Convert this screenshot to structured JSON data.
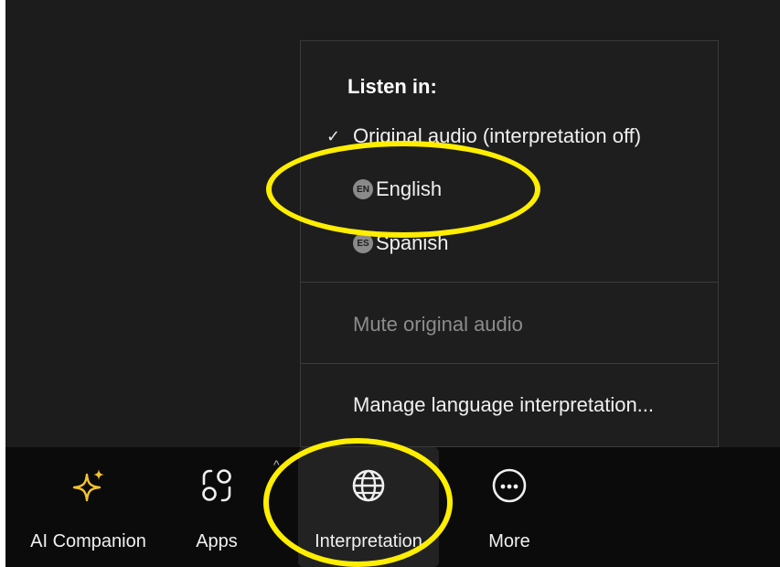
{
  "menu": {
    "heading": "Listen in:",
    "original_audio": {
      "check": "✓",
      "label": "Original audio (interpretation off)"
    },
    "languages": [
      {
        "badge": "EN",
        "label": "English"
      },
      {
        "badge": "ES",
        "label": "Spanish"
      }
    ],
    "mute_original": "Mute original audio",
    "manage": "Manage language interpretation..."
  },
  "toolbar": {
    "items": [
      {
        "label": "AI Companion",
        "icon": "sparkle-icon"
      },
      {
        "label": "Apps",
        "icon": "apps-icon"
      },
      {
        "label": "Interpretation",
        "icon": "globe-icon"
      },
      {
        "label": "More",
        "icon": "more-icon"
      }
    ],
    "apps_caret": "^"
  },
  "colors": {
    "background": "#1c1c1c",
    "toolbar": "#0b0b0b",
    "highlight": "#ffee00",
    "ai_companion": "#f2c230"
  }
}
